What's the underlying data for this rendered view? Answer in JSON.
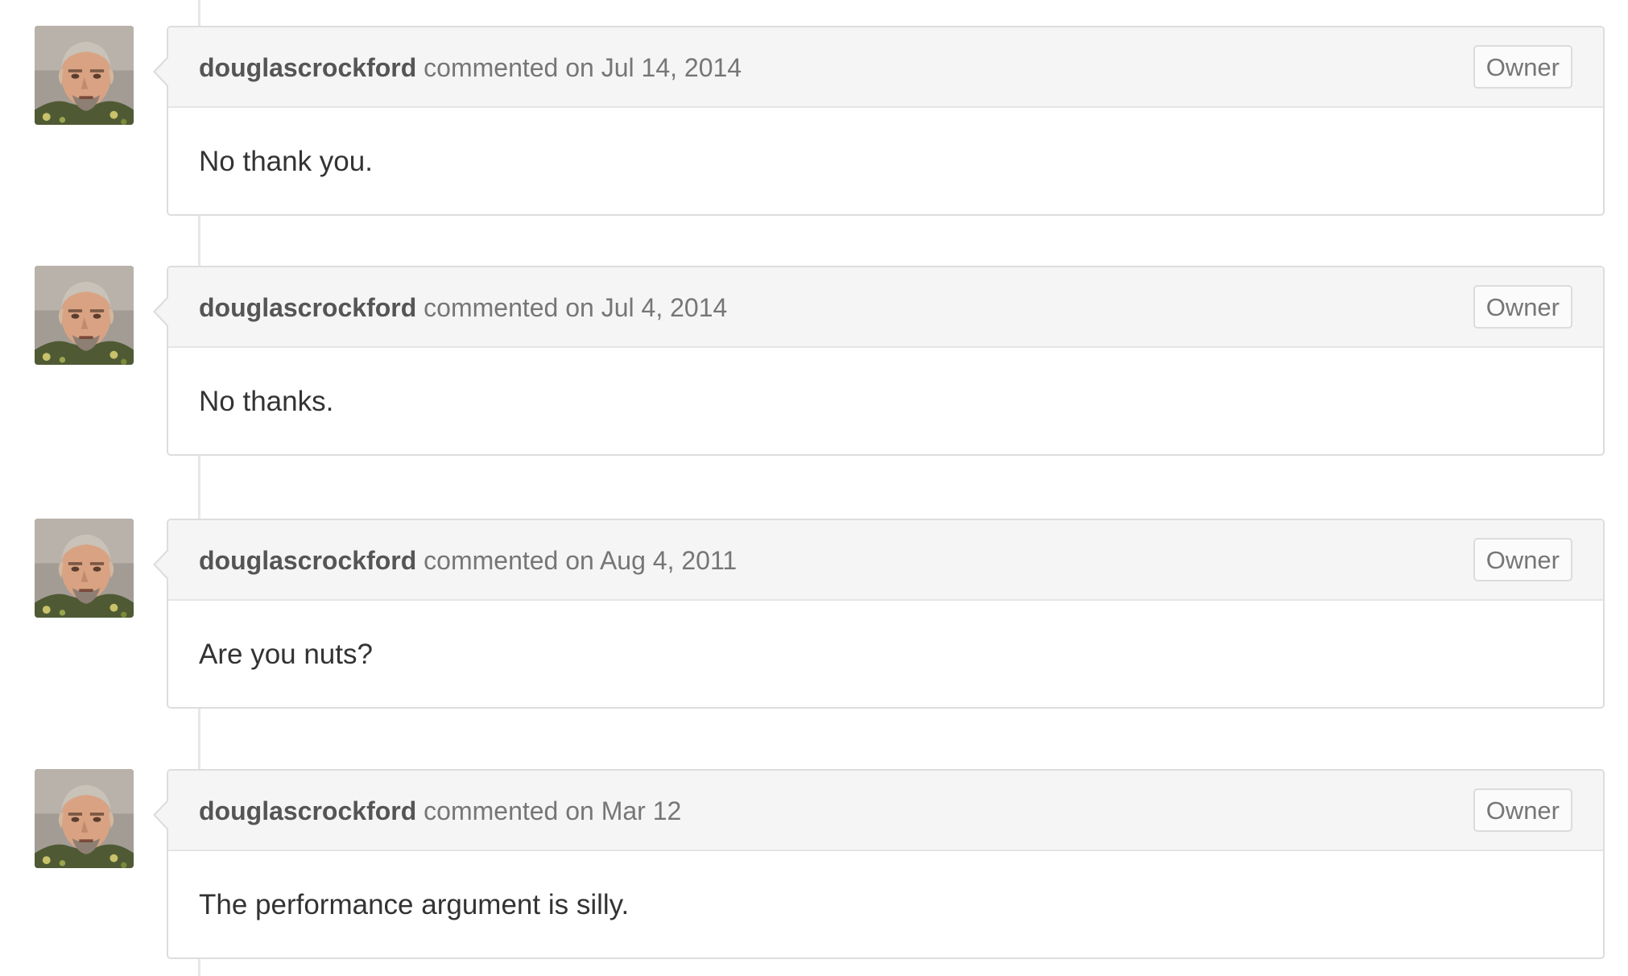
{
  "comments": [
    {
      "author": "douglascrockford",
      "action": "commented on Jul 14, 2014",
      "badge": "Owner",
      "body": "No thank you."
    },
    {
      "author": "douglascrockford",
      "action": "commented on Jul 4, 2014",
      "badge": "Owner",
      "body": "No thanks."
    },
    {
      "author": "douglascrockford",
      "action": "commented on Aug 4, 2011",
      "badge": "Owner",
      "body": "Are you nuts?"
    },
    {
      "author": "douglascrockford",
      "action": "commented on Mar 12",
      "badge": "Owner",
      "body": "The performance argument is silly."
    }
  ]
}
